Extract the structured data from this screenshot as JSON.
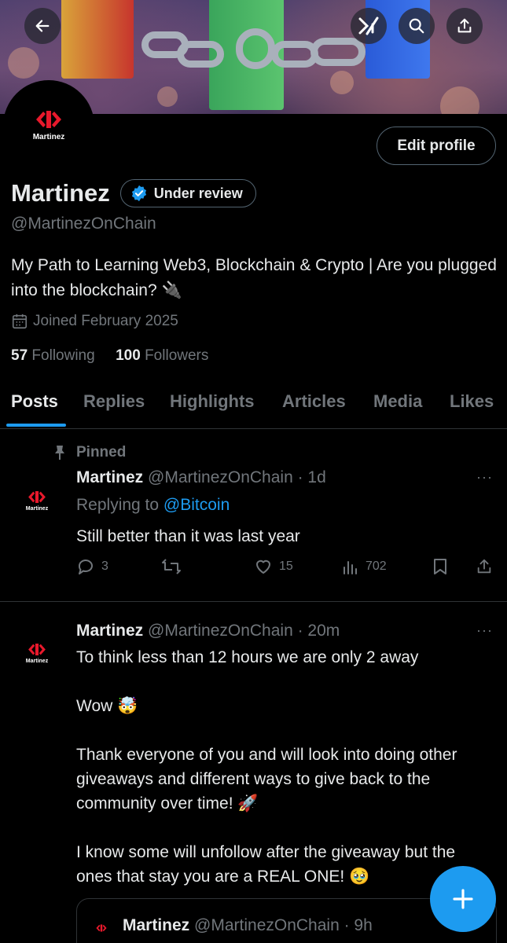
{
  "profile": {
    "avatar_text": "Martinez",
    "display_name": "Martinez",
    "review_badge": "Under review",
    "handle": "@MartinezOnChain",
    "bio": "My Path to Learning Web3, Blockchain & Crypto | Are you plugged into the blockchain? 🔌",
    "joined": "Joined February 2025",
    "following_count": "57",
    "following_label": "Following",
    "followers_count": "100",
    "followers_label": "Followers",
    "edit_label": "Edit profile"
  },
  "tabs": [
    {
      "label": "Posts",
      "active": true
    },
    {
      "label": "Replies"
    },
    {
      "label": "Highlights"
    },
    {
      "label": "Articles"
    },
    {
      "label": "Media"
    },
    {
      "label": "Likes"
    }
  ],
  "posts": [
    {
      "pinned_label": "Pinned",
      "author": "Martinez",
      "handle_time": "@MartinezOnChain · 1d",
      "reply_prefix": "Replying to",
      "reply_to": "@Bitcoin",
      "text": "Still better than it was last year",
      "replies": "3",
      "reposts": "",
      "likes": "15",
      "views": "702",
      "avatar_text": "Martinez"
    },
    {
      "author": "Martinez",
      "handle_time": "@MartinezOnChain · 20m",
      "text": "To think less than 12 hours we are only 2 away\n\nWow 🤯\n\nThank everyone of you and will look into doing other giveaways and different ways to give back to the community over time! 🚀\n\nI know some will unfollow after the giveaway but the ones that stay you are a REAL ONE! 🥹",
      "avatar_text": "Martinez"
    }
  ],
  "quote": {
    "author": "Martinez",
    "handle_time": "@MartinezOnChain · 9h"
  },
  "more_glyph": "···",
  "colors": {
    "accent": "#1d9bf0",
    "muted": "#71767b",
    "text": "#e7e9ea",
    "logo_red": "#e8192c"
  },
  "icons": [
    "back-arrow-icon",
    "grok-icon",
    "search-icon",
    "share-icon",
    "verified-icon",
    "calendar-icon",
    "pin-icon",
    "reply-icon",
    "repost-icon",
    "like-icon",
    "views-icon",
    "bookmark-icon",
    "compose-plus-icon"
  ]
}
